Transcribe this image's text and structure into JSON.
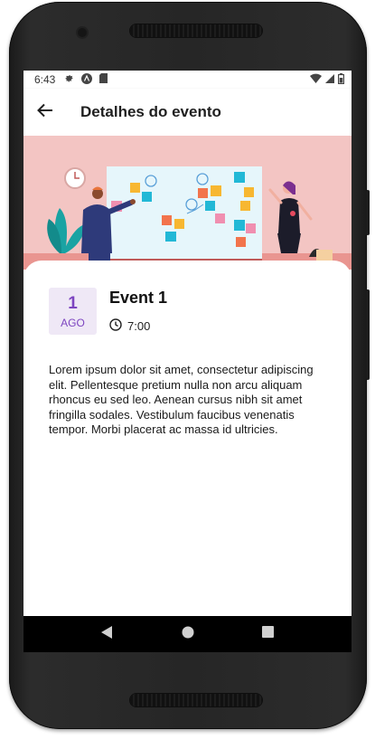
{
  "status_bar": {
    "time": "6:43",
    "left_icons": [
      "gear-icon",
      "android-icon",
      "sd-card-icon"
    ],
    "right_icons": [
      "wifi-icon",
      "cell-signal-icon",
      "battery-icon"
    ]
  },
  "app_bar": {
    "back_icon": "arrow-left-icon",
    "title": "Detalhes do evento"
  },
  "event": {
    "day": "1",
    "month": "AGO",
    "title": "Event 1",
    "time": "7:00",
    "description": "Lorem ipsum dolor sit amet, consectetur adipiscing elit. Pellentesque pretium nulla non arcu aliquam rhoncus eu sed leo. Aenean cursus nibh sit amet fringilla sodales. Vestibulum faucibus venenatis tempor. Morbi placerat ac massa id ultricies."
  },
  "nav_bar": {
    "items": [
      "back-triangle-icon",
      "home-circle-icon",
      "recents-square-icon"
    ]
  },
  "colors": {
    "accent": "#7d45c0",
    "date_bg": "#efe8f6",
    "hero_bg": "#f3c5c3",
    "nav_bg": "#000000"
  }
}
